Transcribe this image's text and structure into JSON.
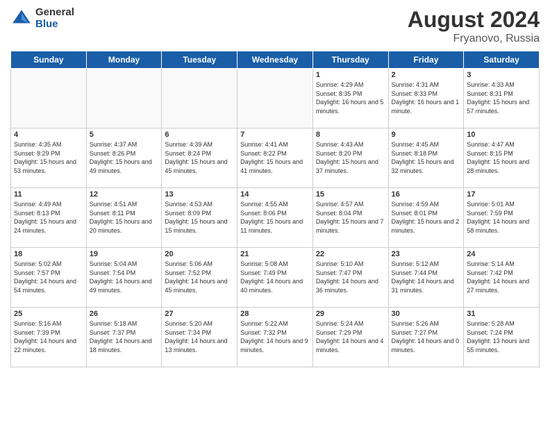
{
  "header": {
    "logo_general": "General",
    "logo_blue": "Blue",
    "month_year": "August 2024",
    "location": "Fryanovo, Russia"
  },
  "weekdays": [
    "Sunday",
    "Monday",
    "Tuesday",
    "Wednesday",
    "Thursday",
    "Friday",
    "Saturday"
  ],
  "weeks": [
    [
      {
        "day": "",
        "sunrise": "",
        "sunset": "",
        "daylight": ""
      },
      {
        "day": "",
        "sunrise": "",
        "sunset": "",
        "daylight": ""
      },
      {
        "day": "",
        "sunrise": "",
        "sunset": "",
        "daylight": ""
      },
      {
        "day": "",
        "sunrise": "",
        "sunset": "",
        "daylight": ""
      },
      {
        "day": "1",
        "sunrise": "4:29 AM",
        "sunset": "8:35 PM",
        "daylight": "16 hours and 5 minutes."
      },
      {
        "day": "2",
        "sunrise": "4:31 AM",
        "sunset": "8:33 PM",
        "daylight": "16 hours and 1 minute."
      },
      {
        "day": "3",
        "sunrise": "4:33 AM",
        "sunset": "8:31 PM",
        "daylight": "15 hours and 57 minutes."
      }
    ],
    [
      {
        "day": "4",
        "sunrise": "4:35 AM",
        "sunset": "8:29 PM",
        "daylight": "15 hours and 53 minutes."
      },
      {
        "day": "5",
        "sunrise": "4:37 AM",
        "sunset": "8:26 PM",
        "daylight": "15 hours and 49 minutes."
      },
      {
        "day": "6",
        "sunrise": "4:39 AM",
        "sunset": "8:24 PM",
        "daylight": "15 hours and 45 minutes."
      },
      {
        "day": "7",
        "sunrise": "4:41 AM",
        "sunset": "8:22 PM",
        "daylight": "15 hours and 41 minutes."
      },
      {
        "day": "8",
        "sunrise": "4:43 AM",
        "sunset": "8:20 PM",
        "daylight": "15 hours and 37 minutes."
      },
      {
        "day": "9",
        "sunrise": "4:45 AM",
        "sunset": "8:18 PM",
        "daylight": "15 hours and 32 minutes."
      },
      {
        "day": "10",
        "sunrise": "4:47 AM",
        "sunset": "8:15 PM",
        "daylight": "15 hours and 28 minutes."
      }
    ],
    [
      {
        "day": "11",
        "sunrise": "4:49 AM",
        "sunset": "8:13 PM",
        "daylight": "15 hours and 24 minutes."
      },
      {
        "day": "12",
        "sunrise": "4:51 AM",
        "sunset": "8:11 PM",
        "daylight": "15 hours and 20 minutes."
      },
      {
        "day": "13",
        "sunrise": "4:53 AM",
        "sunset": "8:09 PM",
        "daylight": "15 hours and 15 minutes."
      },
      {
        "day": "14",
        "sunrise": "4:55 AM",
        "sunset": "8:06 PM",
        "daylight": "15 hours and 11 minutes."
      },
      {
        "day": "15",
        "sunrise": "4:57 AM",
        "sunset": "8:04 PM",
        "daylight": "15 hours and 7 minutes."
      },
      {
        "day": "16",
        "sunrise": "4:59 AM",
        "sunset": "8:01 PM",
        "daylight": "15 hours and 2 minutes."
      },
      {
        "day": "17",
        "sunrise": "5:01 AM",
        "sunset": "7:59 PM",
        "daylight": "14 hours and 58 minutes."
      }
    ],
    [
      {
        "day": "18",
        "sunrise": "5:02 AM",
        "sunset": "7:57 PM",
        "daylight": "14 hours and 54 minutes."
      },
      {
        "day": "19",
        "sunrise": "5:04 AM",
        "sunset": "7:54 PM",
        "daylight": "14 hours and 49 minutes."
      },
      {
        "day": "20",
        "sunrise": "5:06 AM",
        "sunset": "7:52 PM",
        "daylight": "14 hours and 45 minutes."
      },
      {
        "day": "21",
        "sunrise": "5:08 AM",
        "sunset": "7:49 PM",
        "daylight": "14 hours and 40 minutes."
      },
      {
        "day": "22",
        "sunrise": "5:10 AM",
        "sunset": "7:47 PM",
        "daylight": "14 hours and 36 minutes."
      },
      {
        "day": "23",
        "sunrise": "5:12 AM",
        "sunset": "7:44 PM",
        "daylight": "14 hours and 31 minutes."
      },
      {
        "day": "24",
        "sunrise": "5:14 AM",
        "sunset": "7:42 PM",
        "daylight": "14 hours and 27 minutes."
      }
    ],
    [
      {
        "day": "25",
        "sunrise": "5:16 AM",
        "sunset": "7:39 PM",
        "daylight": "14 hours and 22 minutes."
      },
      {
        "day": "26",
        "sunrise": "5:18 AM",
        "sunset": "7:37 PM",
        "daylight": "14 hours and 18 minutes."
      },
      {
        "day": "27",
        "sunrise": "5:20 AM",
        "sunset": "7:34 PM",
        "daylight": "14 hours and 13 minutes."
      },
      {
        "day": "28",
        "sunrise": "5:22 AM",
        "sunset": "7:32 PM",
        "daylight": "14 hours and 9 minutes."
      },
      {
        "day": "29",
        "sunrise": "5:24 AM",
        "sunset": "7:29 PM",
        "daylight": "14 hours and 4 minutes."
      },
      {
        "day": "30",
        "sunrise": "5:26 AM",
        "sunset": "7:27 PM",
        "daylight": "14 hours and 0 minutes."
      },
      {
        "day": "31",
        "sunrise": "5:28 AM",
        "sunset": "7:24 PM",
        "daylight": "13 hours and 55 minutes."
      }
    ]
  ],
  "labels": {
    "sunrise": "Sunrise:",
    "sunset": "Sunset:",
    "daylight": "Daylight:"
  }
}
